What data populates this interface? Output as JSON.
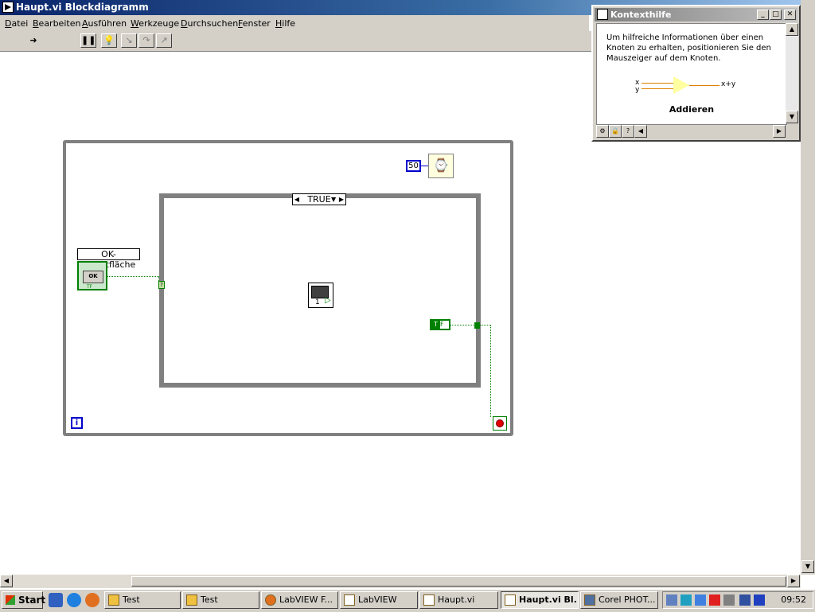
{
  "window": {
    "title": "Haupt.vi Blockdiagramm"
  },
  "menu": [
    "Datei",
    "Bearbeiten",
    "Ausführen",
    "Werkzeuge",
    "Durchsuchen",
    "Fenster",
    "Hilfe"
  ],
  "toolbar": {
    "run_icon": "run-arrow-icon",
    "pause_icon": "pause-icon",
    "highlight_icon": "highlight-execution-icon",
    "step_icons": [
      "step-into-icon",
      "step-over-icon",
      "step-out-icon"
    ]
  },
  "diagram": {
    "case_selector": "TRUE",
    "wait_constant": "50",
    "ok_label": "OK-Schaltfläche",
    "ok_button": "OK",
    "ok_tf": "TF",
    "tunnel_symbol": "?",
    "subvi_number": "1",
    "bool_const": "T",
    "bool_const_suffix": "F",
    "iteration": "i"
  },
  "context_help": {
    "title": "Kontexthilfe",
    "text": "Um hilfreiche Informationen über einen Knoten zu erhalten, positionieren Sie den Mauszeiger auf dem Knoten.",
    "node_name": "Addieren",
    "input_x": "x",
    "input_y": "y",
    "output": "x+y"
  },
  "taskbar": {
    "start": "Start",
    "tasks": [
      "Test",
      "Test",
      "LabVIEW F...",
      "LabVIEW",
      "Haupt.vi",
      "Haupt.vi Bl...",
      "Corel PHOT..."
    ],
    "active_index": 5,
    "clock": "09:52"
  }
}
